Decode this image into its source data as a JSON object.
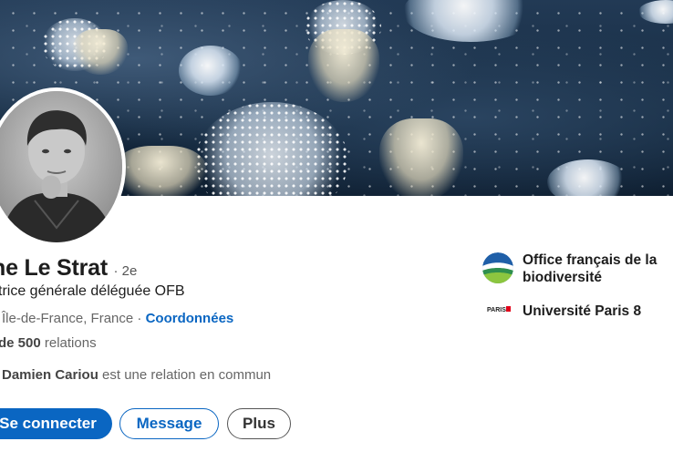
{
  "profile": {
    "name": "ne Le Strat",
    "degree": "· 2e",
    "headline": "trice générale déléguée OFB",
    "location": "Île-de-France, France",
    "location_separator": "·",
    "contact_link": "Coordonnées",
    "relations_count": "de 500",
    "relations_label": "relations",
    "mutual_name": "Damien Cariou",
    "mutual_text": "est une relation en commun"
  },
  "actions": {
    "connect_label": "Se connecter",
    "message_label": "Message",
    "more_label": "Plus"
  },
  "organizations": [
    {
      "name": "Office français de la biodiversité",
      "icon": "ofb-logo-icon"
    },
    {
      "name": "Université Paris 8",
      "icon": "paris8-logo-icon",
      "logo_text": "PARIS8"
    }
  ],
  "colors": {
    "accent": "#0a66c2",
    "text_primary": "#1d1d1d",
    "text_secondary": "#666666",
    "banner": "#1a3149"
  }
}
